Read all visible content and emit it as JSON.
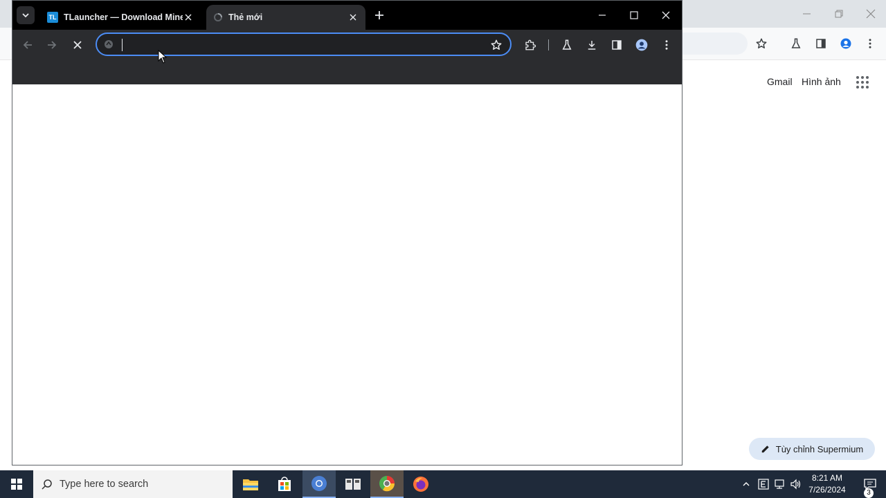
{
  "background_browser": {
    "links": {
      "gmail": "Gmail",
      "images": "Hình ảnh"
    },
    "customize_button_label": "Tùy chỉnh Supermium",
    "icons": [
      "minimize-icon",
      "restore-icon",
      "close-icon",
      "star-icon",
      "labs-icon",
      "side-panel-icon",
      "profile-icon",
      "menu-icon",
      "apps-grid-icon",
      "pencil-icon"
    ]
  },
  "foreground_browser": {
    "tabs": [
      {
        "title": "TLauncher — Download Minec",
        "favicon_text": "TL",
        "active": false
      },
      {
        "title": "Thẻ mới",
        "active": true
      }
    ],
    "omnibox": {
      "value": "",
      "placeholder": ""
    },
    "loading": true,
    "colors": {
      "frame": "#000000",
      "toolbar": "#2b2c2f",
      "omnibox_focus": "#4c8df6",
      "content": "#ffffff"
    }
  },
  "taskbar": {
    "search_placeholder": "Type here to search",
    "apps": [
      "file-explorer",
      "microsoft-store",
      "chrome",
      "app-4",
      "supermium",
      "firefox"
    ],
    "clock": {
      "time": "8:21 AM",
      "date": "7/26/2024"
    },
    "notification_count": "3",
    "colors": {
      "bar": "#1f2a3a"
    }
  }
}
